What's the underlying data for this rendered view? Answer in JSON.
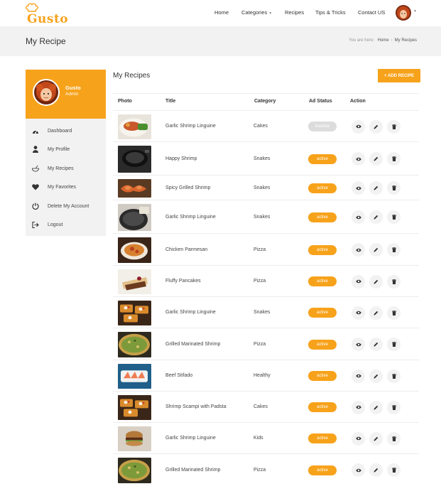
{
  "header": {
    "logo_text": "Gusto",
    "nav": [
      {
        "label": "Home"
      },
      {
        "label": "Categories",
        "has_caret": true
      },
      {
        "label": "Recipes"
      },
      {
        "label": "Tips & Tricks"
      },
      {
        "label": "Contact US"
      }
    ]
  },
  "title_band": {
    "page_title": "My Recipe",
    "breadcrumb_prefix": "You are here:",
    "breadcrumb_home": "Home",
    "breadcrumb_current": "My Recipes"
  },
  "profile": {
    "name": "Gusto",
    "role": "Admin"
  },
  "sidebar_menu": [
    {
      "label": "Dashboard",
      "icon": "dashboard-icon"
    },
    {
      "label": "My Profile",
      "icon": "user-icon"
    },
    {
      "label": "My Recipes",
      "icon": "bowl-icon"
    },
    {
      "label": "My Favorites",
      "icon": "heart-icon"
    },
    {
      "label": "Delete My Account",
      "icon": "power-icon"
    },
    {
      "label": "Logout",
      "icon": "logout-icon"
    }
  ],
  "main": {
    "title": "My Recipes",
    "add_button": "+ ADD RECIPE",
    "columns": {
      "photo": "Photo",
      "title": "Title",
      "category": "Category",
      "status": "Ad Status",
      "action": "Action"
    },
    "rows": [
      {
        "title": "Garlic Shrimp Linguine",
        "category": "Cakes",
        "status": "inactive",
        "photo": "plated-dish"
      },
      {
        "title": "Happy Shrimp",
        "category": "Snakes",
        "status": "active",
        "photo": "dark-pot"
      },
      {
        "title": "Spicy Grilled Shrimp",
        "category": "Snakes",
        "status": "active",
        "photo": "grilled-shrimp"
      },
      {
        "title": "Garlic Shrimp Linguine",
        "category": "Snakes",
        "status": "active",
        "photo": "skillet"
      },
      {
        "title": "Chicken Parmesan",
        "category": "Pizza",
        "status": "active",
        "photo": "pasta-bowl"
      },
      {
        "title": "Fluffy Pancakes",
        "category": "Pizza",
        "status": "active",
        "photo": "crepes"
      },
      {
        "title": "Garlic Shrimp Linguine",
        "category": "Snakes",
        "status": "active",
        "photo": "bruschetta"
      },
      {
        "title": "Grilled Marinated Shrimp",
        "category": "Pizza",
        "status": "active",
        "photo": "green-pizza"
      },
      {
        "title": "Beef Stifado",
        "category": "Healthy",
        "status": "active",
        "photo": "salmon-slices"
      },
      {
        "title": "Shrimp Scampi with Padsta",
        "category": "Cakes",
        "status": "active",
        "photo": "bruschetta"
      },
      {
        "title": "Garlic Shrimp Linguine",
        "category": "Kids",
        "status": "active",
        "photo": "burger"
      },
      {
        "title": "Grilled Marinated Shrimp",
        "category": "Pizza",
        "status": "active",
        "photo": "green-pizza"
      }
    ]
  },
  "colors": {
    "accent": "#f7a21b",
    "band": "#f2f2f2",
    "inactive": "#dcdcdc"
  }
}
